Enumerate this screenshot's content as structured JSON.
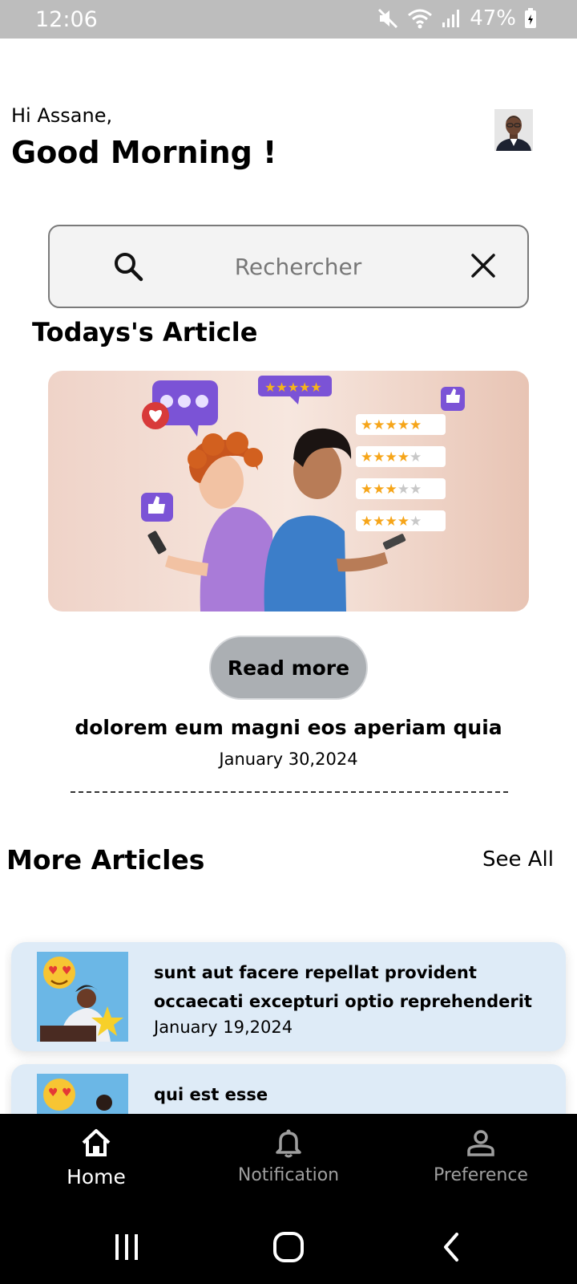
{
  "status_bar": {
    "time": "12:06",
    "battery": "47%"
  },
  "header": {
    "greeting": "Hi Assane,",
    "headline": "Good Morning !"
  },
  "search": {
    "placeholder": "Rechercher",
    "value": ""
  },
  "today": {
    "section_title": "Todays's Article",
    "read_more": "Read more",
    "title": "dolorem eum magni eos aperiam quia",
    "date": "January 30,2024"
  },
  "more": {
    "section_title": "More Articles",
    "see_all": "See All",
    "items": [
      {
        "title": "sunt aut facere repellat provident occaecati excepturi optio reprehenderit",
        "date": "January 19,2024"
      },
      {
        "title": "qui est esse",
        "date": ""
      }
    ]
  },
  "nav": {
    "items": [
      {
        "label": "Home",
        "icon": "home-icon",
        "active": true
      },
      {
        "label": "Notification",
        "icon": "bell-icon",
        "active": false
      },
      {
        "label": "Preference",
        "icon": "person-icon",
        "active": false
      }
    ]
  },
  "colors": {
    "status_bar": "#bdbdbd",
    "search_bg": "#f3f3f3",
    "card_bg": "#deebf7",
    "button_bg": "#abafb3",
    "nav_bg": "#000000"
  }
}
